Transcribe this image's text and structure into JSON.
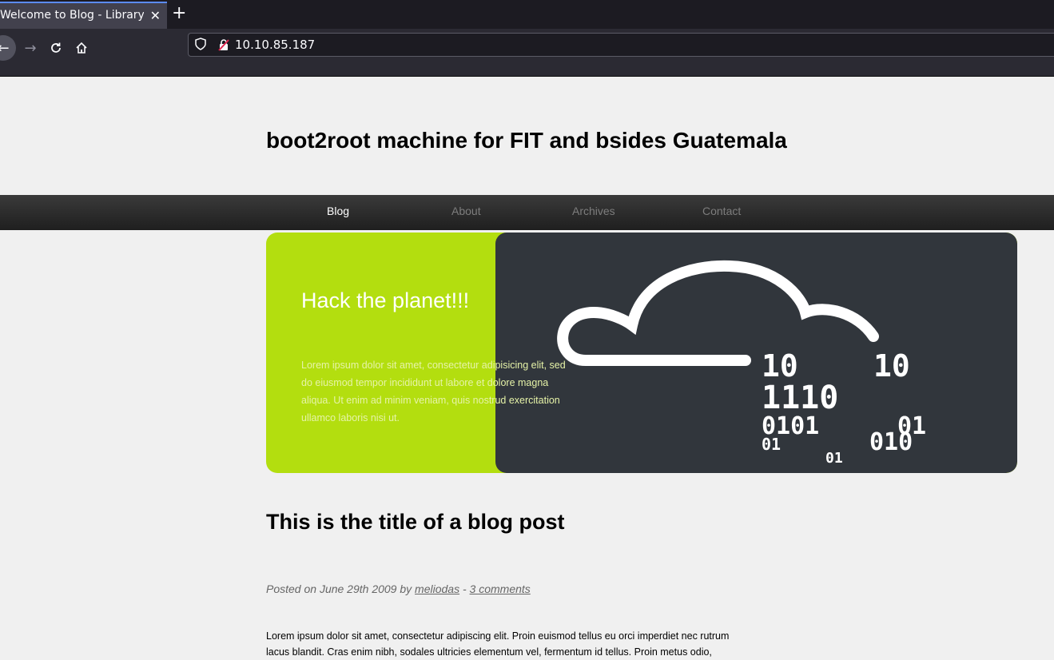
{
  "browser": {
    "tab_title": "Welcome to Blog - Library M",
    "new_tab_symbol": "+",
    "close_symbol": "✕",
    "url": "10.10.85.187"
  },
  "site": {
    "title": "boot2root machine for FIT and bsides Guatemala"
  },
  "menu": {
    "items": [
      {
        "label": "Blog",
        "active": true
      },
      {
        "label": "About",
        "active": false
      },
      {
        "label": "Archives",
        "active": false
      },
      {
        "label": "Contact",
        "active": false
      }
    ]
  },
  "hero": {
    "title": "Hack the planet!!!",
    "text": "Lorem ipsum dolor sit amet, consectetur adipisicing elit, sed do eiusmod tempor incididunt ut labore et dolore magna aliqua. Ut enim ad minim veniam, quis nostrud exercitation ullamco laboris nisi ut.",
    "accent_color": "#b3de0f",
    "dark_color": "#31363c",
    "binary_lines": [
      "10",
      "10",
      "1110",
      "0101",
      "01",
      "01",
      "010",
      "01"
    ]
  },
  "post": {
    "title": "This is the title of a blog post",
    "meta_prefix": "Posted on June 29th 2009 by",
    "author": "meliodas",
    "separator": "-",
    "comments": "3 comments",
    "body": "Lorem ipsum dolor sit amet, consectetur adipiscing elit. Proin euismod tellus eu orci imperdiet nec rutrum lacus blandit. Cras enim nibh, sodales ultricies elementum vel, fermentum id tellus. Proin metus odio,"
  }
}
